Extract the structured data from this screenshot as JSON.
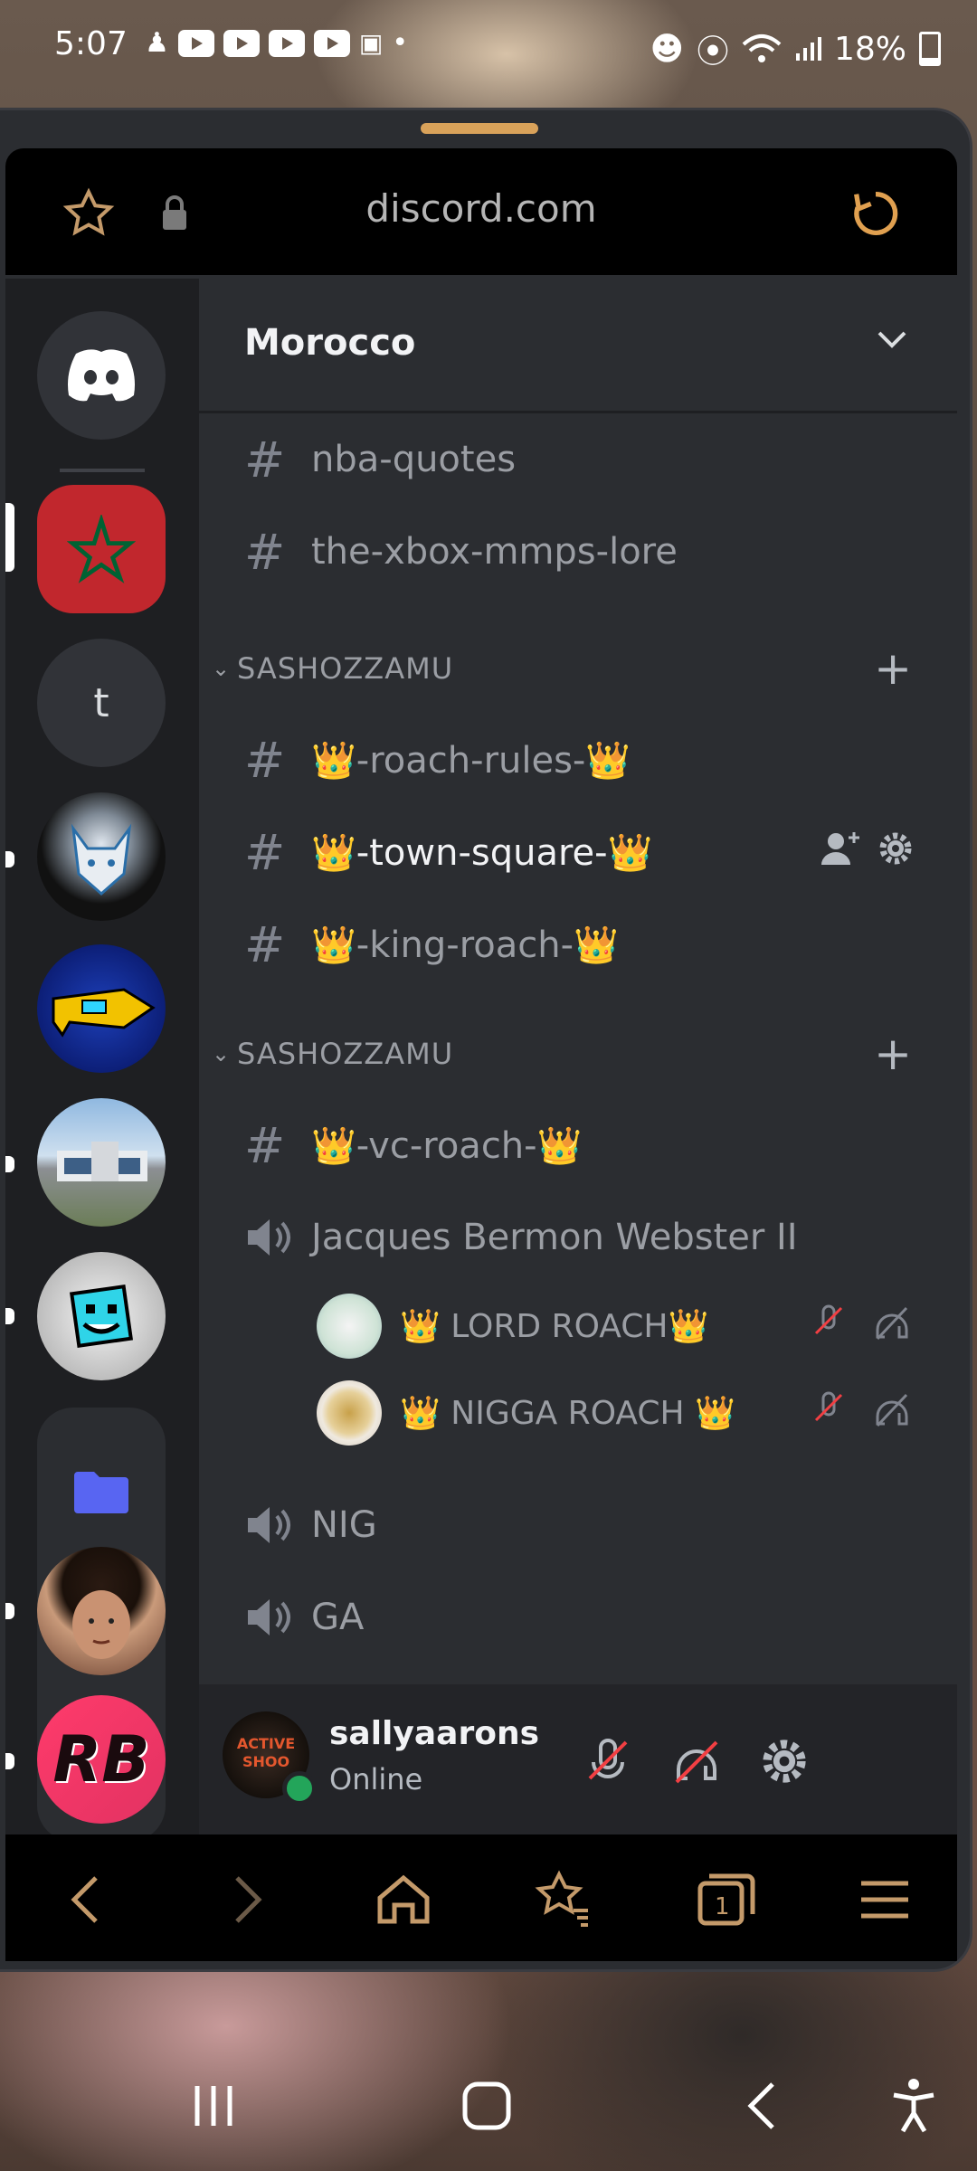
{
  "status_bar": {
    "time": "5:07",
    "battery": "18%"
  },
  "browser": {
    "url": "discord.com"
  },
  "server": {
    "name": "Morocco"
  },
  "channels_top": [
    {
      "name": "nba-quotes"
    },
    {
      "name": "the-xbox-mmps-lore"
    }
  ],
  "categories": [
    {
      "name": "SASHOZZAMU",
      "channels": [
        {
          "name": "👑-roach-rules-👑",
          "active": false
        },
        {
          "name": "👑-town-square-👑",
          "active": true
        },
        {
          "name": "👑-king-roach-👑",
          "active": false
        }
      ]
    },
    {
      "name": "SASHOZZAMU",
      "channels": [
        {
          "name": "👑-vc-roach-👑"
        }
      ],
      "voice": [
        {
          "name": "Jacques Bermon Webster II",
          "users": [
            {
              "name": "👑 LORD ROACH👑"
            },
            {
              "name": "👑 NIGGA ROACH 👑"
            }
          ]
        },
        {
          "name": "NIG",
          "users": []
        },
        {
          "name": "GA",
          "users": []
        }
      ]
    }
  ],
  "user": {
    "name": "sallyaarons",
    "status": "Online",
    "avatar_text": "ACTIVE SHOO"
  },
  "servers_list": {
    "home_icon": "discord-logo-icon",
    "dm_letter": "t",
    "folder_icon": "folder-icon",
    "rb_text": "RB"
  },
  "colors": {
    "accent": "#5865f2",
    "online": "#23a55a",
    "url_icon": "#c49a6a",
    "muted_red": "#f23f43"
  }
}
